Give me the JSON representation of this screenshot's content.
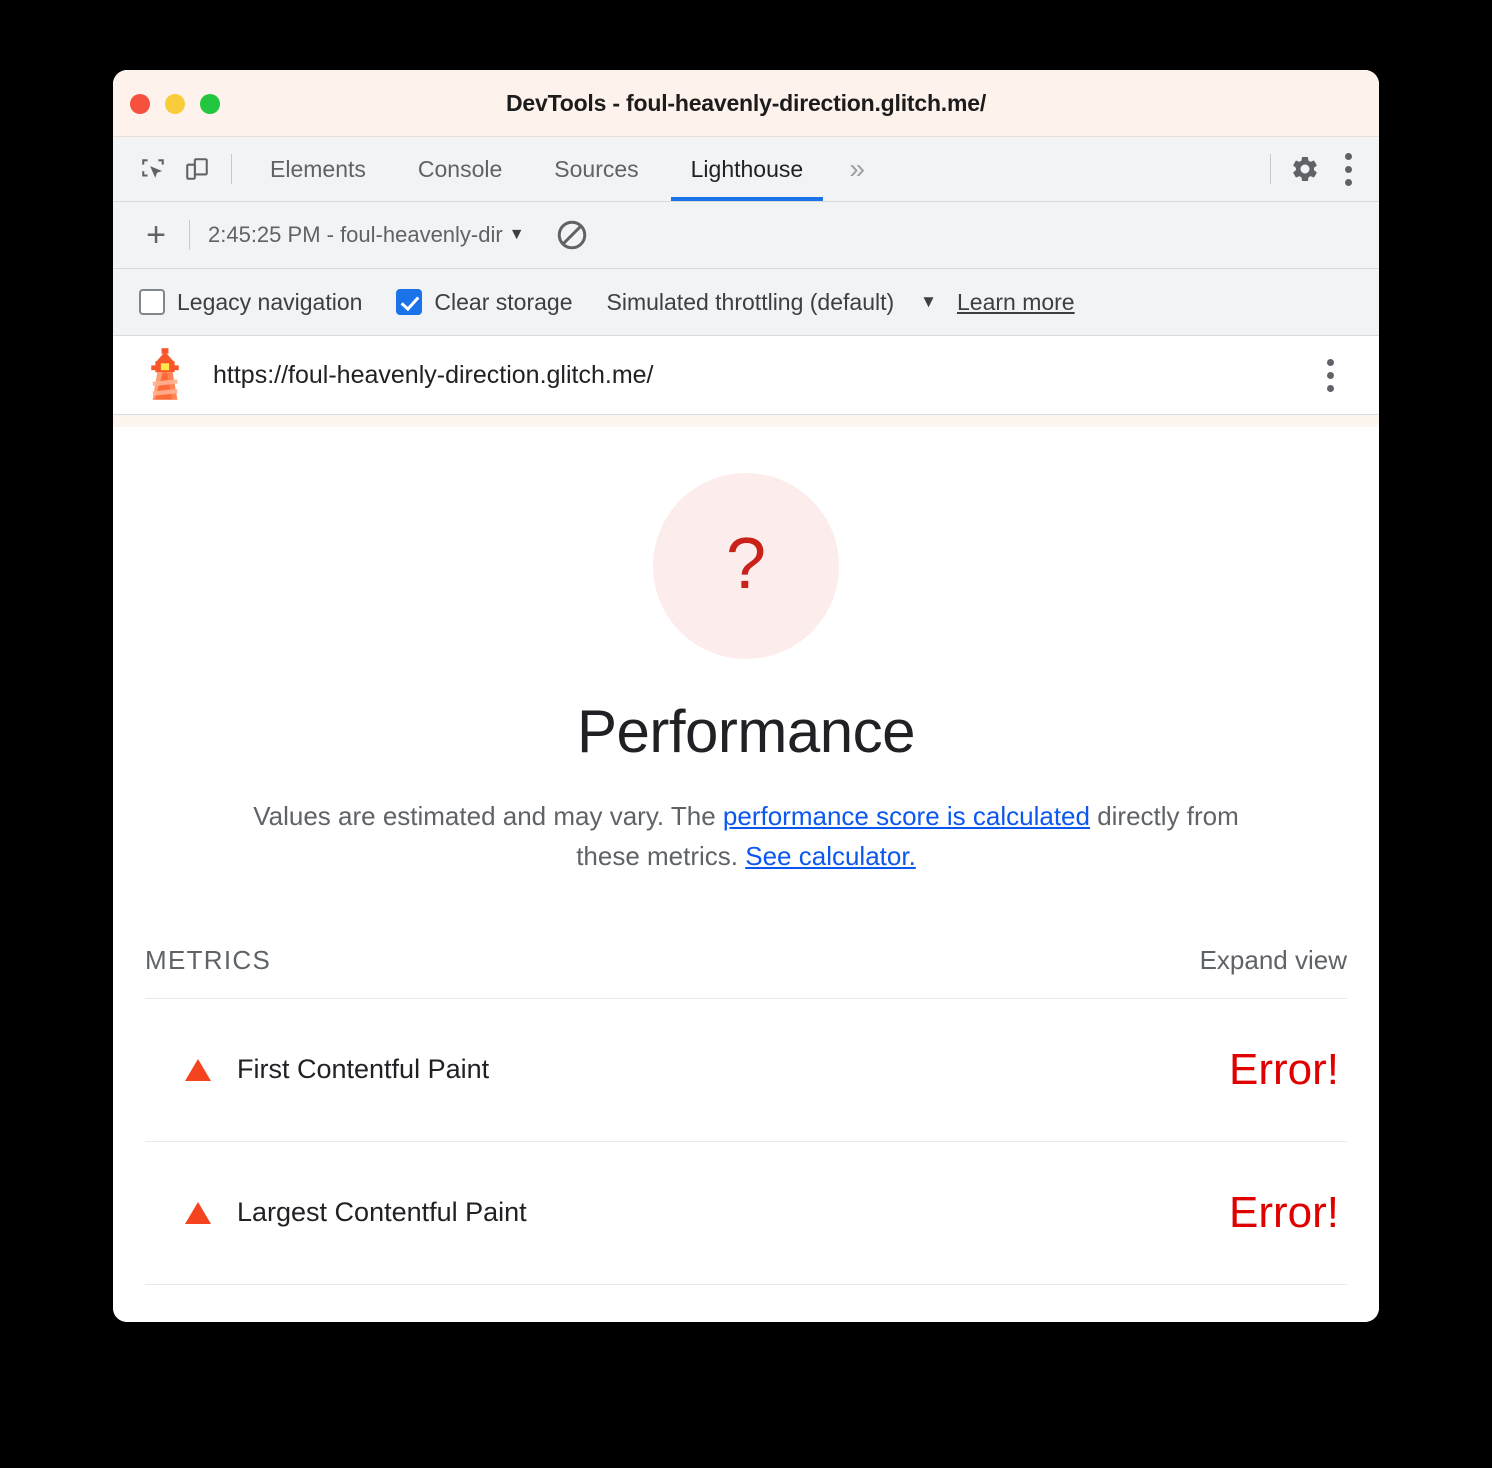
{
  "window": {
    "title": "DevTools - foul-heavenly-direction.glitch.me/",
    "traffic_lights": [
      "close",
      "minimize",
      "maximize"
    ]
  },
  "devtools_tabbar": {
    "inspect_icon": "inspect-element-icon",
    "device_icon": "device-toolbar-icon",
    "tabs": [
      {
        "label": "Elements",
        "active": false
      },
      {
        "label": "Console",
        "active": false
      },
      {
        "label": "Sources",
        "active": false
      },
      {
        "label": "Lighthouse",
        "active": true
      }
    ],
    "more_tabs": "»",
    "settings_icon": "gear-icon",
    "menu_icon": "kebab-menu-icon"
  },
  "lighthouse_toolbar": {
    "add_label": "+",
    "report_select_value": "2:45:25 PM - foul-heavenly-dir",
    "dropdown_caret": "▼",
    "clear_icon": "no-entry-icon"
  },
  "settings_row": {
    "legacy_navigation": {
      "label": "Legacy navigation",
      "checked": false
    },
    "clear_storage": {
      "label": "Clear storage",
      "checked": true
    },
    "throttling": {
      "label": "Simulated throttling (default)",
      "caret": "▼"
    },
    "learn_more": "Learn more"
  },
  "url_row": {
    "logo": "lighthouse-logo-icon",
    "url": "https://foul-heavenly-direction.glitch.me/",
    "menu_icon": "kebab-menu-icon"
  },
  "report": {
    "gauge": {
      "value": "?",
      "color": "#c9221a",
      "bg": "#fdecec"
    },
    "category_title": "Performance",
    "description": {
      "part1": "Values are estimated and may vary. The ",
      "link1": "performance score is calculated",
      "part2": " directly from these metrics. ",
      "link2": "See calculator."
    },
    "metrics_header": {
      "title": "METRICS",
      "expand_view": "Expand view"
    },
    "metrics": [
      {
        "name": "First Contentful Paint",
        "value": "Error!",
        "status": "error"
      },
      {
        "name": "Largest Contentful Paint",
        "value": "Error!",
        "status": "error"
      }
    ]
  },
  "colors": {
    "accent_blue": "#1a73e8",
    "link_blue": "#0b57f0",
    "error_red": "#e10000",
    "warning_triangle": "#f4441f",
    "titlebar_bg": "#fdf2ec",
    "toolbar_bg": "#f1f3f4"
  }
}
